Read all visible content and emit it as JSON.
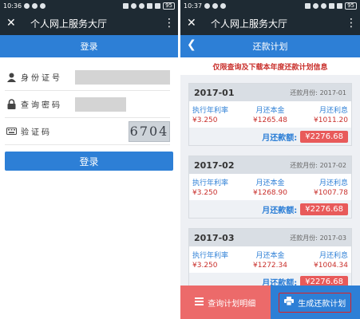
{
  "left": {
    "status": {
      "time": "10:36",
      "battery": "95"
    },
    "appbar": {
      "title": "个人网上服务大厅"
    },
    "header": {
      "title": "登录"
    },
    "form": {
      "id_label": "身份证号",
      "password_label": "查询密码",
      "captcha_label": "验证码",
      "captcha_text": "6704"
    },
    "login_button": "登录"
  },
  "right": {
    "status": {
      "time": "10:37",
      "battery": "95"
    },
    "appbar": {
      "title": "个人网上服务大厅"
    },
    "header": {
      "title": "还款计划"
    },
    "notice": "仅限查询及下载本年度还款计划信息",
    "cards": [
      {
        "year": "2017-01",
        "month_label": "还款月份:",
        "month": "2017-01",
        "rate_label": "执行年利率",
        "principal_label": "月还本金",
        "interest_label": "月还利息",
        "rate": "¥3.250",
        "principal": "¥1265.48",
        "interest": "¥1011.20",
        "total_label": "月还款额:",
        "total": "¥2276.68"
      },
      {
        "year": "2017-02",
        "month_label": "还款月份:",
        "month": "2017-02",
        "rate_label": "执行年利率",
        "principal_label": "月还本金",
        "interest_label": "月还利息",
        "rate": "¥3.250",
        "principal": "¥1268.90",
        "interest": "¥1007.78",
        "total_label": "月还款额:",
        "total": "¥2276.68"
      },
      {
        "year": "2017-03",
        "month_label": "还款月份:",
        "month": "2017-03",
        "rate_label": "执行年利率",
        "principal_label": "月还本金",
        "interest_label": "月还利息",
        "rate": "¥3.250",
        "principal": "¥1272.34",
        "interest": "¥1004.34",
        "total_label": "月还款额:",
        "total": "¥2276.68"
      }
    ],
    "bottom": {
      "query_button": "查询计划明细",
      "generate_button": "生成还款计划"
    }
  },
  "colors": {
    "dark_bar": "#1e2a33",
    "brand_blue": "#2d7fd6",
    "accent_red": "#e85a5a"
  },
  "icons": [
    "close-icon",
    "more-icon",
    "back-icon",
    "user-icon",
    "lock-icon",
    "keyboard-icon",
    "list-icon",
    "print-icon"
  ]
}
